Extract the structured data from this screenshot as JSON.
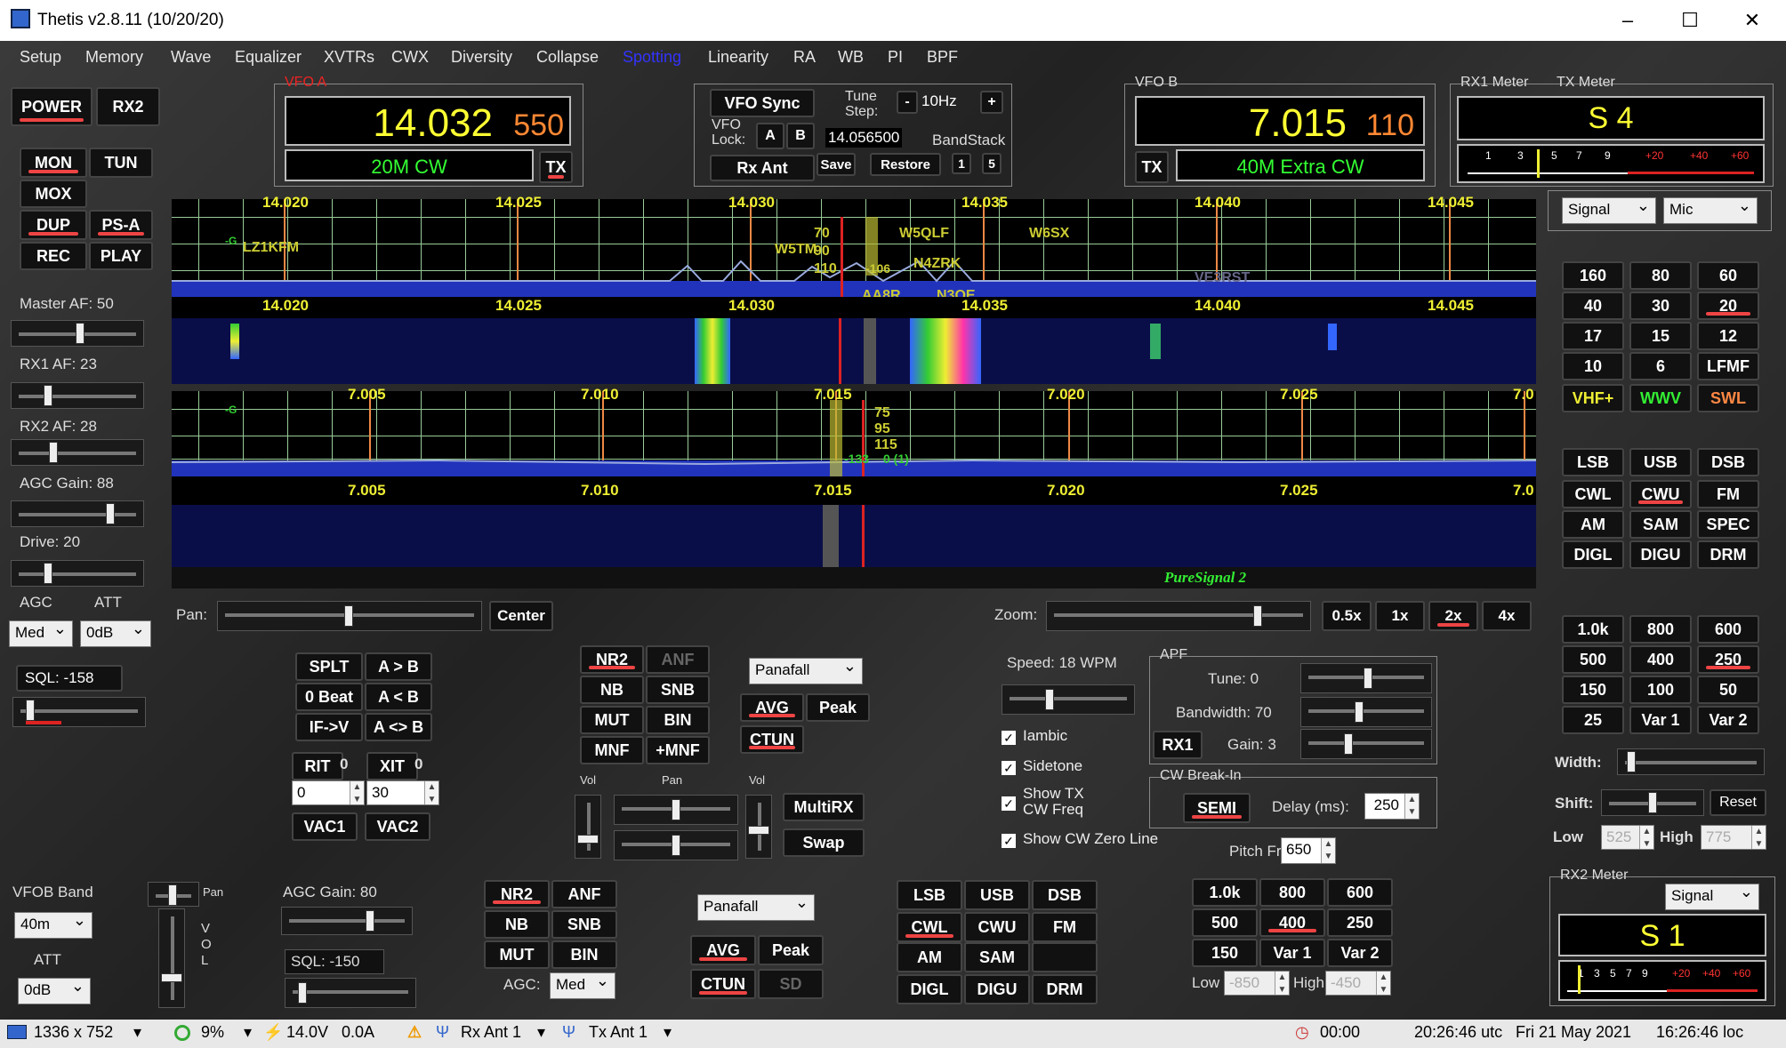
{
  "window": {
    "title": "Thetis v2.8.11 (10/20/20)",
    "min": "–",
    "max": "☐",
    "close": "✕"
  },
  "menu": [
    "Setup",
    "Memory",
    "Wave",
    "Equalizer",
    "XVTRs",
    "CWX",
    "Diversity",
    "Collapse",
    "Spotting",
    "Linearity",
    "RA",
    "WB",
    "PI",
    "BPF"
  ],
  "left": {
    "power": "POWER",
    "rx2": "RX2",
    "mon": "MON",
    "tun": "TUN",
    "mox": "MOX",
    "dup": "DUP",
    "psa": "PS-A",
    "rec": "REC",
    "play": "PLAY",
    "master_af": "Master AF:  50",
    "rx1_af": "RX1 AF:  23",
    "rx2_af": "RX2 AF:  28",
    "agc_gain": "AGC Gain:  88",
    "drive": "Drive:  20",
    "agc_label": "AGC",
    "att_label": "ATT",
    "agc_value": "Med",
    "att_value": "0dB",
    "sql": "SQL:  -158"
  },
  "vfoa": {
    "caption": "VFO A",
    "freq_main": "14.032",
    "freq_sub": "550",
    "mode": "20M CW",
    "tx": "TX"
  },
  "vfob": {
    "caption": "VFO B",
    "freq_main": "7.015",
    "freq_sub": "110",
    "mode": "40M Extra CW",
    "tx": "TX"
  },
  "center": {
    "vfo_sync": "VFO Sync",
    "tune_step_label": "Tune\nStep:",
    "tune_minus": "-",
    "tune_step": "10Hz",
    "tune_plus": "+",
    "vfo_lock": "VFO\nLock:",
    "lock_a": "A",
    "lock_b": "B",
    "lock_freq": "14.056500",
    "bandstack": "BandStack",
    "rx_ant": "Rx Ant",
    "save": "Save",
    "restore": "Restore",
    "bs1": "1",
    "bs5": "5"
  },
  "meters": {
    "rx1": "RX1 Meter",
    "tx": "TX Meter",
    "reading": "S 4",
    "scale": [
      "1",
      "3",
      "5",
      "7",
      "9",
      "+20",
      "+40",
      "+60"
    ],
    "sel1": "Signal",
    "sel2": "Mic",
    "rx2": "RX2 Meter",
    "rx2_sel": "Signal",
    "rx2_reading": "S 1"
  },
  "bands": [
    "160",
    "80",
    "60",
    "40",
    "30",
    "20",
    "17",
    "15",
    "12",
    "10",
    "6",
    "LFMF",
    "VHF+",
    "WWV",
    "SWL"
  ],
  "modes": [
    "LSB",
    "USB",
    "DSB",
    "CWL",
    "CWU",
    "FM",
    "AM",
    "SAM",
    "SPEC",
    "DIGL",
    "DIGU",
    "DRM"
  ],
  "filters": [
    "1.0k",
    "800",
    "600",
    "500",
    "400",
    "250",
    "150",
    "100",
    "50",
    "25",
    "Var 1",
    "Var 2"
  ],
  "filter_ctl": {
    "width": "Width:",
    "shift": "Shift:",
    "reset": "Reset",
    "low": "Low",
    "low_val": "525",
    "high": "High",
    "high_val": "775"
  },
  "pano1": {
    "top_labels": [
      "14.020",
      "14.025",
      "14.030",
      "14.035",
      "14.040",
      "14.045"
    ],
    "spots": [
      "LZ1KFM",
      "W5TM",
      "W5QLF",
      "W6SX",
      "N4ZRK",
      "AA8R",
      "N3QE",
      "VE3RST",
      "-G",
      "70",
      "90",
      "110",
      "-106"
    ],
    "bottom_labels": [
      "14.020",
      "14.025",
      "14.030",
      "14.035",
      "14.040",
      "14.045"
    ]
  },
  "pano2": {
    "top_labels": [
      "7.005",
      "7.010",
      "7.015",
      "7.020",
      "7.025",
      "7.0"
    ],
    "marks": [
      "-G",
      "75",
      "95",
      "115",
      "-133",
      "0 (1)"
    ],
    "bottom_labels": [
      "7.005",
      "7.010",
      "7.015",
      "7.020",
      "7.025",
      "7.0"
    ],
    "puresignal": "PureSignal 2"
  },
  "pan": {
    "label": "Pan:",
    "center": "Center",
    "zoom": "Zoom:",
    "z05": "0.5x",
    "z1": "1x",
    "z2": "2x",
    "z4": "4x"
  },
  "split": {
    "splt": "SPLT",
    "atob": "A > B",
    "zerobeat": "0 Beat",
    "btoa": "A < B",
    "ifv": "IF->V",
    "swap": "A <> B",
    "rit": "RIT",
    "rit_v": "0",
    "xit": "XIT",
    "xit_v": "0",
    "rit_in": "0",
    "xit_in": "30",
    "vac1": "VAC1",
    "vac2": "VAC2"
  },
  "dsp1": {
    "nr2": "NR2",
    "anf": "ANF",
    "nb": "NB",
    "snb": "SNB",
    "mut": "MUT",
    "bin": "BIN",
    "mnf": "MNF",
    "pmnf": "+MNF",
    "display": "Panafall",
    "avg": "AVG",
    "peak": "Peak",
    "ctun": "CTUN",
    "vol": "Vol",
    "pan": "Pan",
    "vol2": "Vol",
    "multirx": "MultiRX",
    "swap": "Swap"
  },
  "cw": {
    "speed": "Speed:  18 WPM",
    "iambic": "Iambic",
    "sidetone": "Sidetone",
    "showtx": "Show TX\nCW Freq",
    "showzero": "Show CW Zero Line",
    "apf": "APF",
    "tune": "Tune:  0",
    "bandwidth": "Bandwidth:  70",
    "rx1": "RX1",
    "gain": "Gain:  3",
    "breakin": "CW Break-In",
    "semi": "SEMI",
    "delay": "Delay (ms):",
    "delay_v": "250",
    "pitch": "Pitch Freq (Hz):",
    "pitch_v": "650"
  },
  "rx2": {
    "vfob_band": "VFOB Band",
    "band": "40m",
    "att": "ATT",
    "att_v": "0dB",
    "pan": "Pan",
    "vol": "V\nO\nL",
    "agc_gain": "AGC Gain:  80",
    "sql": "SQL:  -150",
    "nr2": "NR2",
    "anf": "ANF",
    "nb": "NB",
    "snb": "SNB",
    "mut": "MUT",
    "bin": "BIN",
    "agc": "AGC:",
    "agc_v": "Med",
    "display": "Panafall",
    "avg": "AVG",
    "peak": "Peak",
    "ctun": "CTUN",
    "sd": "SD",
    "modes": [
      "LSB",
      "USB",
      "DSB",
      "CWL",
      "CWU",
      "FM",
      "AM",
      "SAM",
      "",
      "DIGL",
      "DIGU",
      "DRM"
    ],
    "filters": [
      "1.0k",
      "800",
      "600",
      "500",
      "400",
      "250",
      "150",
      "Var 1",
      "Var 2"
    ],
    "low": "Low",
    "low_v": "-850",
    "high": "High",
    "high_v": "-450"
  },
  "status": {
    "res": "1336 x 752",
    "cpu": "9%",
    "volt": "14.0V",
    "amp": "0.0A",
    "rxant": "Rx Ant 1",
    "txant": "Tx Ant 1",
    "timer": "00:00",
    "utc": "20:26:46 utc",
    "date": "Fri 21 May 2021",
    "loc": "16:26:46 loc"
  }
}
